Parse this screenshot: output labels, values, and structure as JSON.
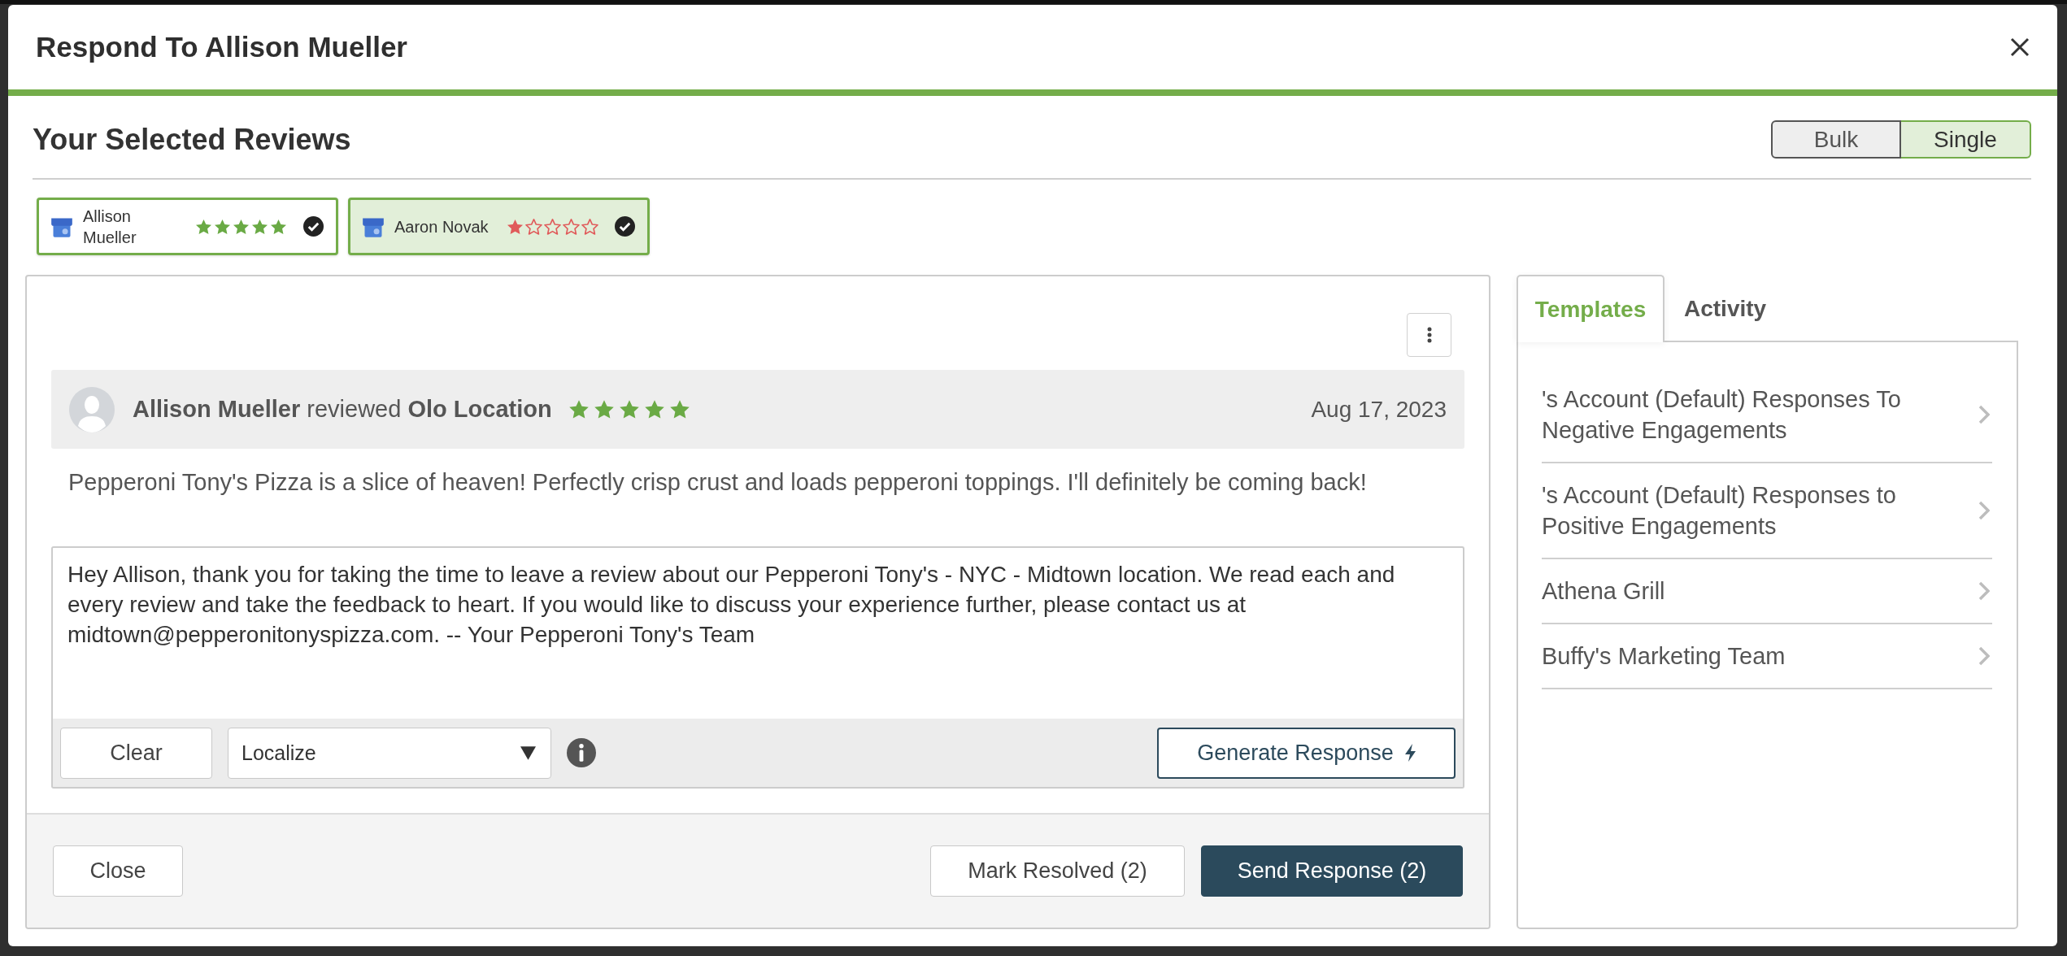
{
  "window": {
    "title": "Respond To Allison Mueller"
  },
  "selected_reviews": {
    "heading": "Your Selected Reviews",
    "modes": [
      {
        "label": "Bulk",
        "selected": false
      },
      {
        "label": "Single",
        "selected": true
      }
    ],
    "chips": [
      {
        "name": "Allison Mueller",
        "stars": 5,
        "color": "#6aaa45",
        "checked": true,
        "selected": false
      },
      {
        "name": "Aaron Novak",
        "stars": 1,
        "color": "#e05a5a",
        "checked": true,
        "selected": true
      }
    ]
  },
  "review": {
    "headline": "**Allison Mueller** reviewed **Olo Location**",
    "stars": 5,
    "date": "Aug 17, 2023",
    "text": "Pepperoni Tony's Pizza is a slice of heaven! Perfectly crisp crust and loads pepperoni toppings. I'll definitely be coming back!"
  },
  "response": {
    "value": "Hey Allison, thank you for taking the time to leave a review about our Pepperoni Tony's - NYC - Midtown location. We read each and every review and take the feedback to heart. If you would like to discuss your experience further, please contact us at midtown@pepperonitonyspizza.com. -- Your Pepperoni Tony's Team",
    "clear_button": "Clear",
    "localize": {
      "value": "Localize"
    },
    "generate_button": "Generate Response"
  },
  "footer": {
    "close_button": "Close",
    "mark_resolved_button": "Mark Resolved (2)",
    "send_button": "Send Response (2)"
  },
  "side_panel": {
    "tabs": [
      {
        "label": "Templates",
        "selected": true
      },
      {
        "label": "Activity",
        "selected": false
      }
    ],
    "templates": [
      {
        "label": "'s Account (Default) Responses To Negative Engagements"
      },
      {
        "label": "'s Account (Default) Responses to Positive Engagements"
      },
      {
        "label": "Athena Grill"
      },
      {
        "label": "Buffy's Marketing Team"
      }
    ]
  }
}
